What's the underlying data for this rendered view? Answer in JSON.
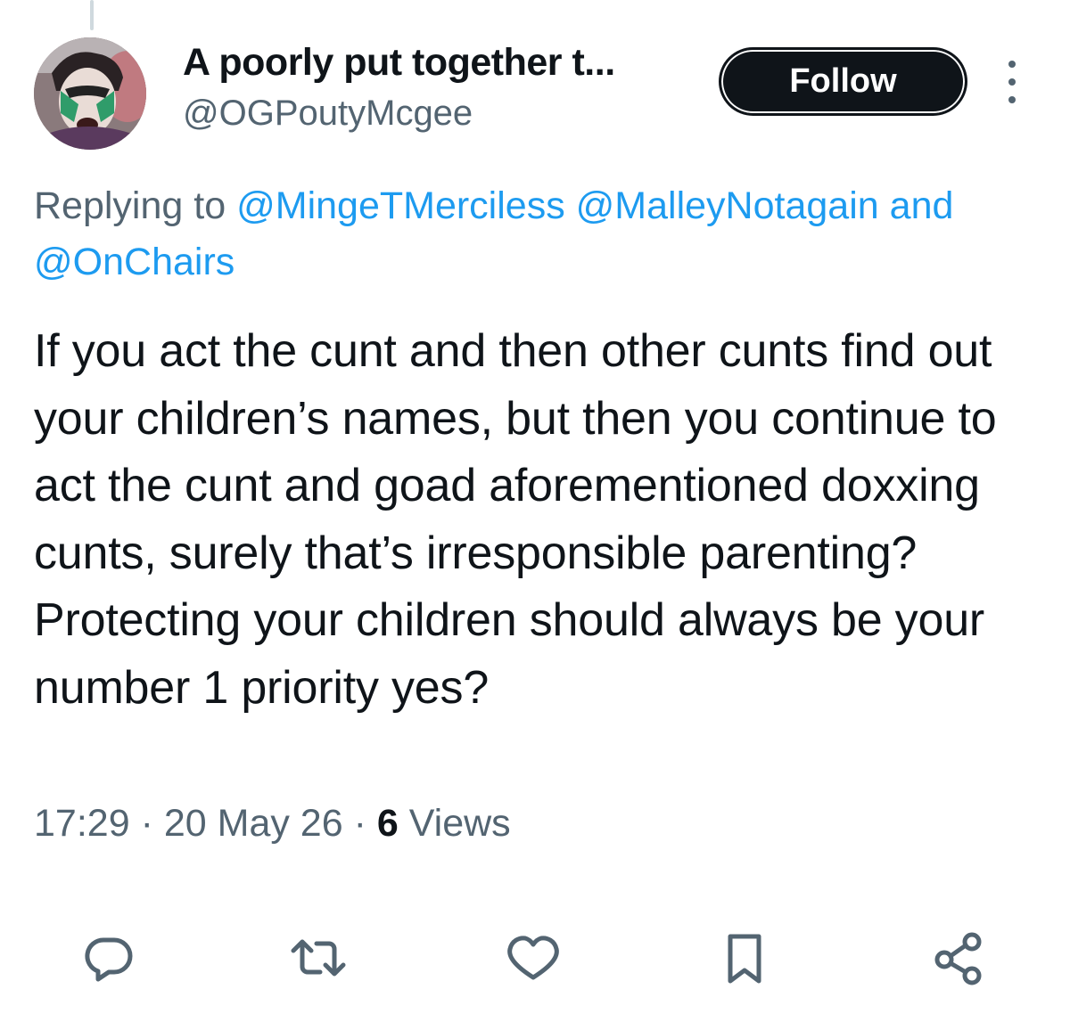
{
  "author": {
    "display_name": "A poorly put together t...",
    "handle": "@OGPoutyMcgee"
  },
  "follow_label": "Follow",
  "more_icon": "more-vertical-icon",
  "replying": {
    "prefix": "Replying to",
    "mention_1": "@MingeTMerciless",
    "mention_2": "@MalleyNotagain",
    "joiner": "and",
    "mention_3": "@OnChairs"
  },
  "tweet_text": "If you act the cunt and then other cunts find out your children’s names, but then you continue to act the cunt and goad aforementioned doxxing cunts, surely that’s irresponsible parenting? Protecting your children should always be your number 1 priority yes?",
  "meta": {
    "time": "17:29",
    "date": "20 May 26",
    "views_count": "6",
    "views_label": "Views",
    "separator": "·"
  },
  "actions": [
    {
      "icon": "reply-icon"
    },
    {
      "icon": "retweet-icon"
    },
    {
      "icon": "like-icon"
    },
    {
      "icon": "bookmark-icon"
    },
    {
      "icon": "share-icon"
    }
  ],
  "colors": {
    "text_primary": "#0f1419",
    "text_secondary": "#536471",
    "link": "#1d9bf0",
    "button_bg": "#0f1419",
    "icon": "#536471"
  }
}
